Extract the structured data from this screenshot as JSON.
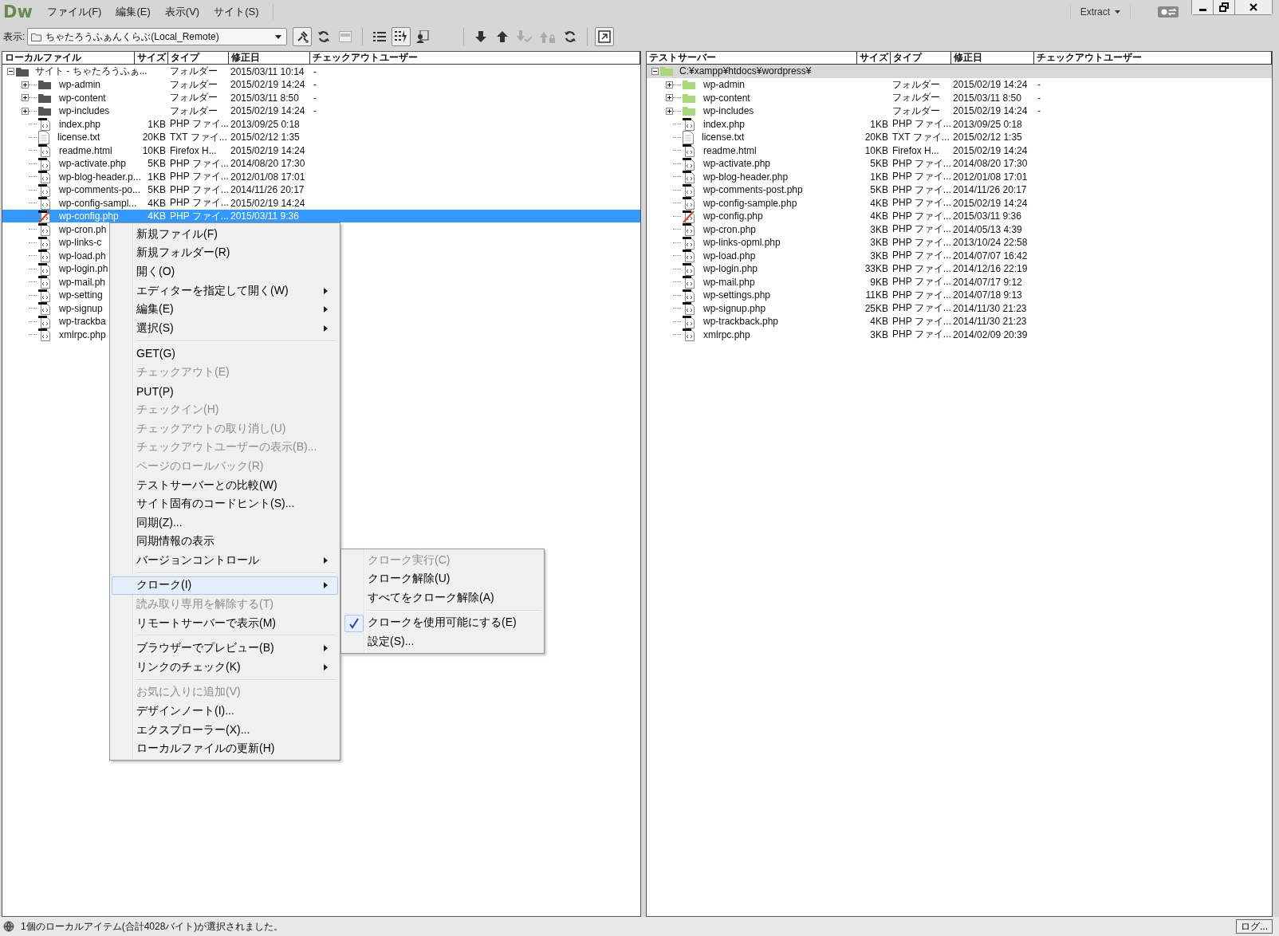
{
  "app": {
    "logo": "Dw",
    "menus": [
      {
        "label": "ファイル(F)"
      },
      {
        "label": "編集(E)"
      },
      {
        "label": "表示(V)"
      },
      {
        "label": "サイト(S)"
      }
    ],
    "workspace": "Extract"
  },
  "toolbar": {
    "view_label": "表示:",
    "site": "ちゃたろうふぁんくらぶ(Local_Remote)"
  },
  "local_pane": {
    "active": true,
    "columns": [
      "ローカルファイル",
      "サイズ",
      "タイプ",
      "修正日",
      "チェックアウトユーザー"
    ],
    "tree": [
      {
        "kind": "root",
        "name": "サイト - ちゃたろうふぁ...",
        "type": "フォルダー",
        "modified": "2015/03/11 10:14",
        "checkout": "-",
        "expanded": true,
        "selected": false,
        "children": [
          {
            "kind": "folder",
            "name": "wp-admin",
            "type": "フォルダー",
            "modified": "2015/02/19 14:24",
            "checkout": "-",
            "expanded": false,
            "selected": false
          },
          {
            "kind": "folder",
            "name": "wp-content",
            "type": "フォルダー",
            "modified": "2015/03/11 8:50",
            "checkout": "-",
            "expanded": false,
            "selected": false
          },
          {
            "kind": "folder",
            "name": "wp-includes",
            "type": "フォルダー",
            "modified": "2015/02/19 14:24",
            "checkout": "-",
            "expanded": false,
            "selected": false
          },
          {
            "kind": "php",
            "name": "index.php",
            "size": "1KB",
            "type": "PHP ファイ...",
            "modified": "2013/09/25 0:18",
            "selected": false
          },
          {
            "kind": "text",
            "name": "license.txt",
            "size": "20KB",
            "type": "TXT ファイ...",
            "modified": "2015/02/12 1:35",
            "selected": false
          },
          {
            "kind": "php",
            "name": "readme.html",
            "size": "10KB",
            "type": "Firefox H...",
            "modified": "2015/02/19 14:24",
            "selected": false
          },
          {
            "kind": "php",
            "name": "wp-activate.php",
            "size": "5KB",
            "type": "PHP ファイ...",
            "modified": "2014/08/20 17:30",
            "selected": false
          },
          {
            "kind": "php",
            "name": "wp-blog-header.p...",
            "size": "1KB",
            "type": "PHP ファイ...",
            "modified": "2012/01/08 17:01",
            "selected": false
          },
          {
            "kind": "php",
            "name": "wp-comments-po...",
            "size": "5KB",
            "type": "PHP ファイ...",
            "modified": "2014/11/26 20:17",
            "selected": false
          },
          {
            "kind": "php",
            "name": "wp-config-sampl...",
            "size": "4KB",
            "type": "PHP ファイ...",
            "modified": "2015/02/19 14:24",
            "selected": false
          },
          {
            "kind": "config",
            "name": "wp-config.php",
            "size": "4KB",
            "type": "PHP ファイ...",
            "modified": "2015/03/11 9:36",
            "selected": true
          },
          {
            "kind": "php",
            "name": "wp-cron.ph",
            "selected": false
          },
          {
            "kind": "php",
            "name": "wp-links-c",
            "selected": false
          },
          {
            "kind": "php",
            "name": "wp-load.ph",
            "selected": false
          },
          {
            "kind": "php",
            "name": "wp-login.ph",
            "selected": false
          },
          {
            "kind": "php",
            "name": "wp-mail.ph",
            "selected": false
          },
          {
            "kind": "php",
            "name": "wp-setting",
            "selected": false
          },
          {
            "kind": "php",
            "name": "wp-signup",
            "selected": false
          },
          {
            "kind": "php",
            "name": "wp-trackba",
            "selected": false
          },
          {
            "kind": "php",
            "name": "xmlrpc.php",
            "selected": false
          }
        ]
      }
    ]
  },
  "remote_pane": {
    "active": false,
    "columns": [
      "テストサーバー",
      "サイズ",
      "タイプ",
      "修正日",
      "チェックアウトユーザー"
    ],
    "tree": [
      {
        "kind": "root",
        "name": "C:¥xampp¥htdocs¥wordpress¥",
        "expanded": true,
        "selected": true,
        "children": [
          {
            "kind": "folder",
            "name": "wp-admin",
            "type": "フォルダー",
            "modified": "2015/02/19 14:24",
            "checkout": "-",
            "expanded": false,
            "selected": false
          },
          {
            "kind": "folder",
            "name": "wp-content",
            "type": "フォルダー",
            "modified": "2015/03/11 8:50",
            "checkout": "-",
            "expanded": false,
            "selected": false
          },
          {
            "kind": "folder",
            "name": "wp-includes",
            "type": "フォルダー",
            "modified": "2015/02/19 14:24",
            "checkout": "-",
            "expanded": false,
            "selected": false
          },
          {
            "kind": "php",
            "name": "index.php",
            "size": "1KB",
            "type": "PHP ファイ...",
            "modified": "2013/09/25 0:18",
            "selected": false
          },
          {
            "kind": "text",
            "name": "license.txt",
            "size": "20KB",
            "type": "TXT ファイ...",
            "modified": "2015/02/12 1:35",
            "selected": false
          },
          {
            "kind": "php",
            "name": "readme.html",
            "size": "10KB",
            "type": "Firefox H...",
            "modified": "2015/02/19 14:24",
            "selected": false
          },
          {
            "kind": "php",
            "name": "wp-activate.php",
            "size": "5KB",
            "type": "PHP ファイ...",
            "modified": "2014/08/20 17:30",
            "selected": false
          },
          {
            "kind": "php",
            "name": "wp-blog-header.php",
            "size": "1KB",
            "type": "PHP ファイ...",
            "modified": "2012/01/08 17:01",
            "selected": false
          },
          {
            "kind": "php",
            "name": "wp-comments-post.php",
            "size": "5KB",
            "type": "PHP ファイ...",
            "modified": "2014/11/26 20:17",
            "selected": false
          },
          {
            "kind": "php",
            "name": "wp-config-sample.php",
            "size": "4KB",
            "type": "PHP ファイ...",
            "modified": "2015/02/19 14:24",
            "selected": false
          },
          {
            "kind": "config",
            "name": "wp-config.php",
            "size": "4KB",
            "type": "PHP ファイ...",
            "modified": "2015/03/11 9:36",
            "selected": false
          },
          {
            "kind": "php",
            "name": "wp-cron.php",
            "size": "3KB",
            "type": "PHP ファイ...",
            "modified": "2014/05/13 4:39",
            "selected": false
          },
          {
            "kind": "php",
            "name": "wp-links-opml.php",
            "size": "3KB",
            "type": "PHP ファイ...",
            "modified": "2013/10/24 22:58",
            "selected": false
          },
          {
            "kind": "php",
            "name": "wp-load.php",
            "size": "3KB",
            "type": "PHP ファイ...",
            "modified": "2014/07/07 16:42",
            "selected": false
          },
          {
            "kind": "php",
            "name": "wp-login.php",
            "size": "33KB",
            "type": "PHP ファイ...",
            "modified": "2014/12/16 22:19",
            "selected": false
          },
          {
            "kind": "php",
            "name": "wp-mail.php",
            "size": "9KB",
            "type": "PHP ファイ...",
            "modified": "2014/07/17 9:12",
            "selected": false
          },
          {
            "kind": "php",
            "name": "wp-settings.php",
            "size": "11KB",
            "type": "PHP ファイ...",
            "modified": "2014/07/18 9:13",
            "selected": false
          },
          {
            "kind": "php",
            "name": "wp-signup.php",
            "size": "25KB",
            "type": "PHP ファイ...",
            "modified": "2014/11/30 21:23",
            "selected": false
          },
          {
            "kind": "php",
            "name": "wp-trackback.php",
            "size": "4KB",
            "type": "PHP ファイ...",
            "modified": "2014/11/30 21:23",
            "selected": false
          },
          {
            "kind": "php",
            "name": "xmlrpc.php",
            "size": "3KB",
            "type": "PHP ファイ...",
            "modified": "2014/02/09 20:39",
            "selected": false
          }
        ]
      }
    ]
  },
  "context_menu": {
    "groups": [
      [
        {
          "label": "新規ファイル(F)",
          "disabled": false,
          "submenu": false,
          "selected": false
        },
        {
          "label": "新規フォルダー(R)",
          "disabled": false,
          "submenu": false,
          "selected": false
        },
        {
          "label": "開く(O)",
          "disabled": false,
          "submenu": false,
          "selected": false
        },
        {
          "label": "エディターを指定して開く(W)",
          "disabled": false,
          "submenu": true,
          "selected": false
        },
        {
          "label": "編集(E)",
          "disabled": false,
          "submenu": true,
          "selected": false
        },
        {
          "label": "選択(S)",
          "disabled": false,
          "submenu": true,
          "selected": false
        }
      ],
      [
        {
          "label": "GET(G)",
          "disabled": false,
          "submenu": false,
          "selected": false
        },
        {
          "label": "チェックアウト(E)",
          "disabled": true,
          "submenu": false,
          "selected": false
        },
        {
          "label": "PUT(P)",
          "disabled": false,
          "submenu": false,
          "selected": false
        },
        {
          "label": "チェックイン(H)",
          "disabled": true,
          "submenu": false,
          "selected": false
        },
        {
          "label": "チェックアウトの取り消し(U)",
          "disabled": true,
          "submenu": false,
          "selected": false
        },
        {
          "label": "チェックアウトユーザーの表示(B)...",
          "disabled": true,
          "submenu": false,
          "selected": false
        },
        {
          "label": "ページのロールバック(R)",
          "disabled": true,
          "submenu": false,
          "selected": false
        },
        {
          "label": "テストサーバーとの比較(W)",
          "disabled": false,
          "submenu": false,
          "selected": false
        },
        {
          "label": "サイト固有のコードヒント(S)...",
          "disabled": false,
          "submenu": false,
          "selected": false
        },
        {
          "label": "同期(Z)...",
          "disabled": false,
          "submenu": false,
          "selected": false
        },
        {
          "label": "同期情報の表示",
          "disabled": false,
          "submenu": false,
          "selected": false
        },
        {
          "label": "バージョンコントロール",
          "disabled": false,
          "submenu": true,
          "selected": false
        }
      ],
      [
        {
          "label": "クローク(I)",
          "disabled": false,
          "submenu": true,
          "selected": true
        },
        {
          "label": "読み取り専用を解除する(T)",
          "disabled": true,
          "submenu": false,
          "selected": false
        },
        {
          "label": "リモートサーバーで表示(M)",
          "disabled": false,
          "submenu": false,
          "selected": false
        }
      ],
      [
        {
          "label": "ブラウザーでプレビュー(B)",
          "disabled": false,
          "submenu": true,
          "selected": false
        },
        {
          "label": "リンクのチェック(K)",
          "disabled": false,
          "submenu": true,
          "selected": false
        }
      ],
      [
        {
          "label": "お気に入りに追加(V)",
          "disabled": true,
          "submenu": false,
          "selected": false
        },
        {
          "label": "デザインノート(I)...",
          "disabled": false,
          "submenu": false,
          "selected": false
        },
        {
          "label": "エクスプローラー(X)...",
          "disabled": false,
          "submenu": false,
          "selected": false
        },
        {
          "label": "ローカルファイルの更新(H)",
          "disabled": false,
          "submenu": false,
          "selected": false
        }
      ]
    ]
  },
  "submenu": {
    "groups": [
      [
        {
          "label": "クローク実行(C)",
          "disabled": true,
          "checked": false
        },
        {
          "label": "クローク解除(U)",
          "disabled": false,
          "checked": false
        },
        {
          "label": "すべてをクローク解除(A)",
          "disabled": false,
          "checked": false
        }
      ],
      [
        {
          "label": "クロークを使用可能にする(E)",
          "disabled": false,
          "checked": true
        },
        {
          "label": "設定(S)...",
          "disabled": false,
          "checked": false
        }
      ]
    ]
  },
  "status_bar": {
    "message": "1個のローカルアイテム(合計4028バイト)が選択されました。",
    "log_button": "ログ..."
  }
}
